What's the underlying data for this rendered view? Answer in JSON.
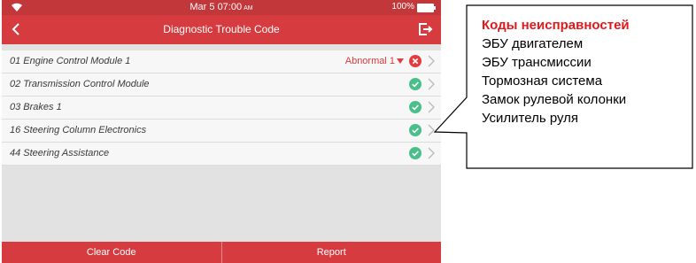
{
  "status_bar": {
    "time": "Mar 5 07:00",
    "ampm": "AM",
    "battery": "100%"
  },
  "header": {
    "title": "Diagnostic Trouble Code"
  },
  "modules": [
    {
      "name": "01 Engine Control Module 1",
      "status_text": "Abnormal 1",
      "status": "error"
    },
    {
      "name": "02 Transmission Control Module",
      "status_text": "",
      "status": "ok"
    },
    {
      "name": "03 Brakes 1",
      "status_text": "",
      "status": "ok"
    },
    {
      "name": "16 Steering Column Electronics",
      "status_text": "",
      "status": "ok"
    },
    {
      "name": "44 Steering Assistance",
      "status_text": "",
      "status": "ok"
    }
  ],
  "footer": {
    "clear_label": "Clear Code",
    "report_label": "Report"
  },
  "callout": {
    "title": "Коды неисправностей",
    "items": [
      "ЭБУ двигателем",
      "ЭБУ трансмиссии",
      "Тормозная система",
      "Замок рулевой колонки",
      "Усилитель руля"
    ]
  },
  "colors": {
    "brand": "#d63c3f",
    "ok": "#4bbf8a",
    "error": "#e23c40",
    "callout_title": "#e0191b"
  },
  "icons": {
    "wifi": "wifi-icon",
    "battery": "battery-icon",
    "back": "back-arrow-icon",
    "exit": "exit-icon",
    "ok": "check-circle-icon",
    "error": "error-circle-icon",
    "dropdown": "caret-down-icon",
    "chevron": "chevron-right-icon"
  }
}
